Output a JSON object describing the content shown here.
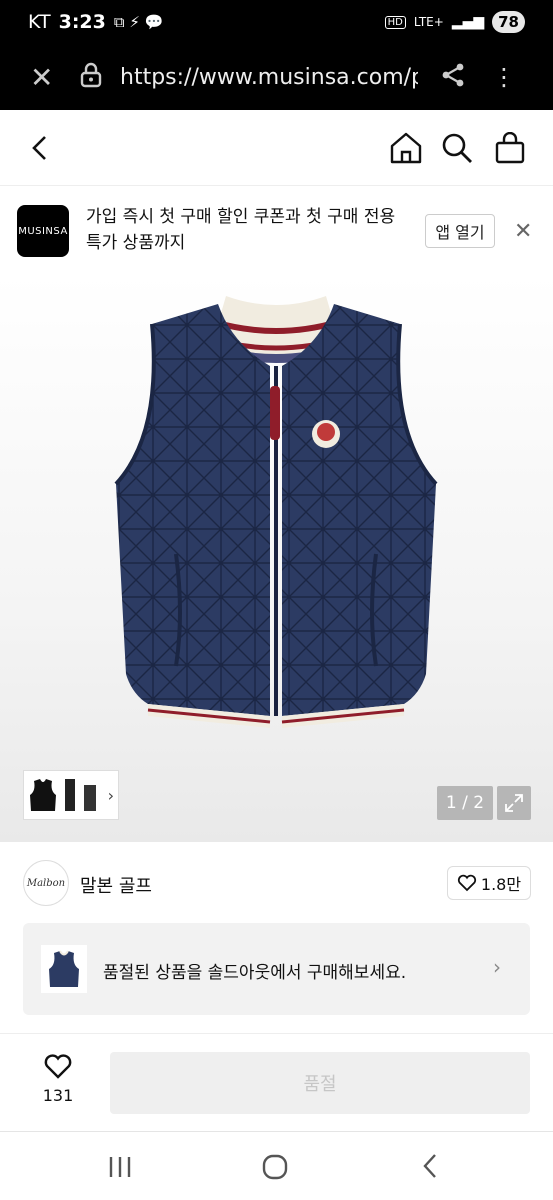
{
  "status_bar": {
    "carrier": "KT",
    "time": "3:23",
    "hd": "HD",
    "network": "LTE+",
    "battery": "78"
  },
  "browser": {
    "url": "https://www.musinsa.com/products"
  },
  "banner": {
    "logo_text": "MUSINSA",
    "message": "가입 즉시 첫 구매 할인 쿠폰과 첫 구매 전용 특가 상품까지",
    "open_app_label": "앱 열기"
  },
  "gallery": {
    "counter": "1 / 2"
  },
  "brand": {
    "avatar_text": "Malbon",
    "name": "말본 골프",
    "likes": "1.8만"
  },
  "soldout_notice": {
    "text": "품절된 상품을 솔드아웃에서 구매해보세요."
  },
  "bottom_bar": {
    "like_count": "131",
    "purchase_label": "품절"
  }
}
